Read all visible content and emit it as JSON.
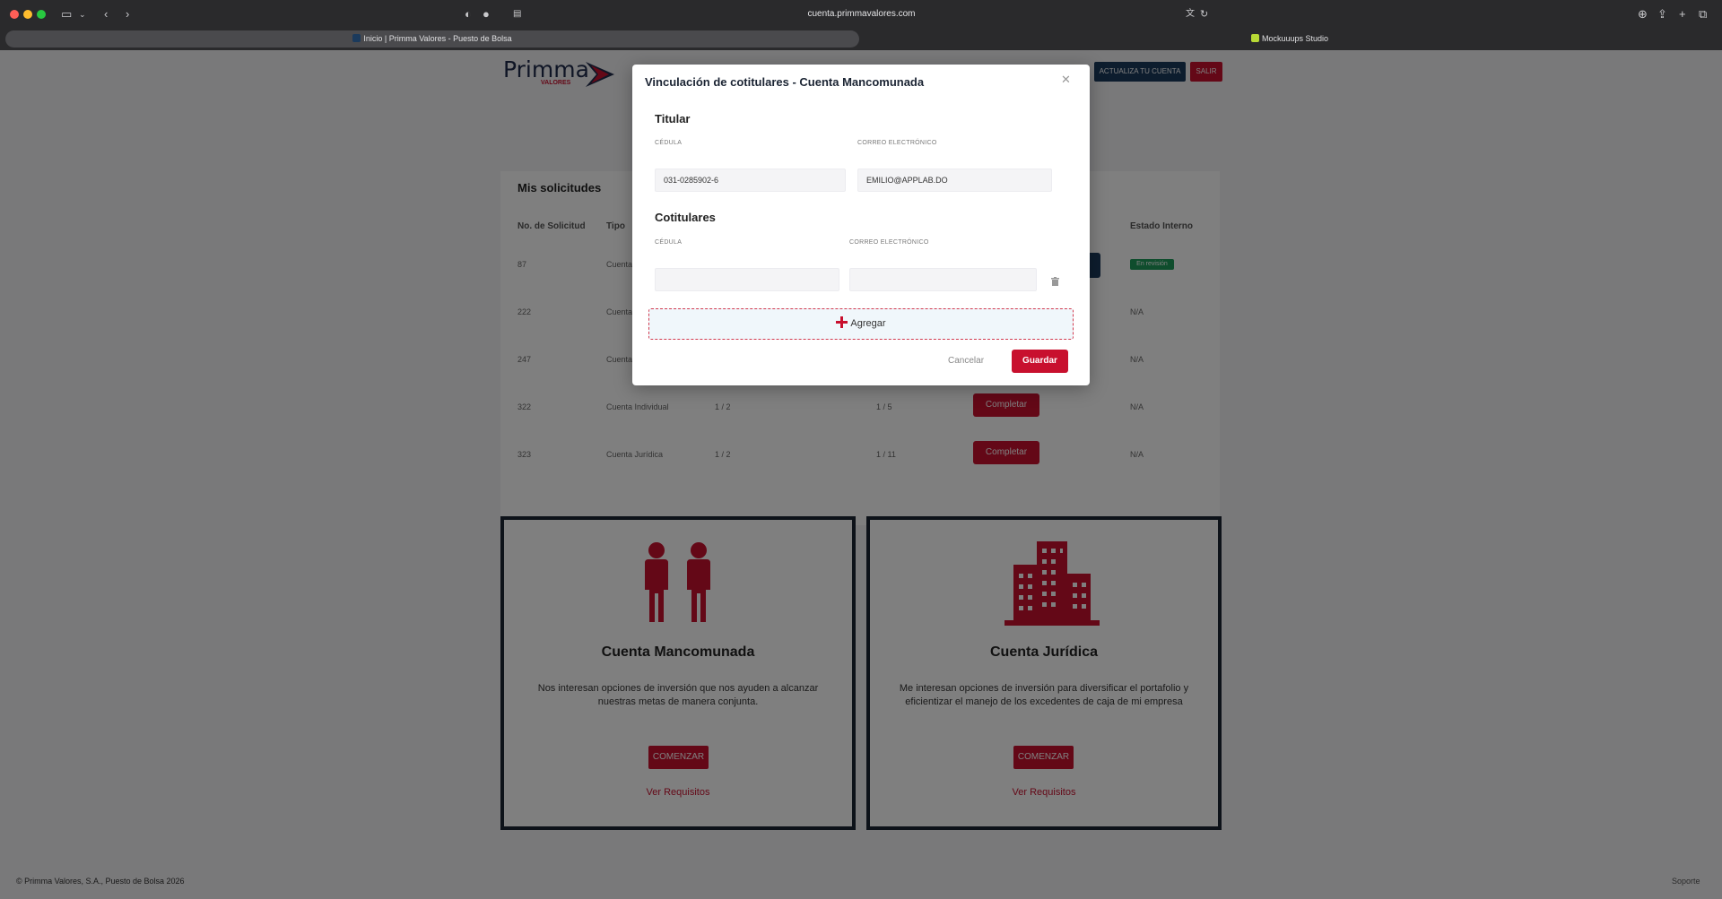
{
  "browser": {
    "url": "cuenta.primmavalores.com",
    "active_tab": "Inicio | Primma Valores - Puesto de Bolsa",
    "other_tab": "Mockuuups Studio"
  },
  "header": {
    "logo_text": "Primma",
    "logo_sub": "VALORES",
    "update_button": "ACTUALIZA TU CUENTA",
    "exit_button": "SALIR"
  },
  "requests": {
    "title": "Mis solicitudes",
    "columns": [
      "No. de Solicitud",
      "Tipo",
      "Estado Interno"
    ],
    "rows": [
      {
        "id": "87",
        "type": "Cuenta",
        "a": "",
        "b": "",
        "status": "En revisión"
      },
      {
        "id": "222",
        "type": "Cuenta",
        "a": "",
        "b": "",
        "status": "N/A"
      },
      {
        "id": "247",
        "type": "Cuenta",
        "a": "",
        "b": "",
        "status": "N/A"
      },
      {
        "id": "322",
        "type": "Cuenta Individual",
        "a": "1 / 2",
        "b": "1 / 5",
        "action": "Completar",
        "status": "N/A"
      },
      {
        "id": "323",
        "type": "Cuenta Jurídica",
        "a": "1 / 2",
        "b": "1 / 11",
        "action": "Completar",
        "status": "N/A"
      }
    ]
  },
  "cards": [
    {
      "title": "Cuenta Mancomunada",
      "desc": "Nos interesan opciones de inversión que nos ayuden a alcanzar nuestras metas de manera conjunta.",
      "button": "COMENZAR",
      "link": "Ver Requisitos",
      "icon": "people-icon"
    },
    {
      "title": "Cuenta Jurídica",
      "desc": "Me interesan opciones de inversión para diversificar el portafolio y eficientizar el manejo de los excedentes de caja de mi empresa",
      "button": "COMENZAR",
      "link": "Ver Requisitos",
      "icon": "building-icon"
    }
  ],
  "footer": {
    "copyright": "© Primma Valores, S.A., Puesto de Bolsa 2026",
    "support": "Soporte"
  },
  "modal": {
    "title": "Vinculación de cotitulares - Cuenta Mancomunada",
    "holder_heading": "Titular",
    "cedula_label": "CÉDULA",
    "email_label": "CORREO ELECTRÓNICO",
    "holder_cedula": "031-0285902-6",
    "holder_email": "EMILIO@APPLAB.DO",
    "coholders_heading": "Cotitulares",
    "coholder_cedula": "",
    "coholder_email": "",
    "add_label": "Agregar",
    "cancel_label": "Cancelar",
    "save_label": "Guardar"
  },
  "colors": {
    "brand_red": "#c8102e",
    "brand_navy": "#1b3a5c",
    "badge_green": "#1f9a5b"
  }
}
